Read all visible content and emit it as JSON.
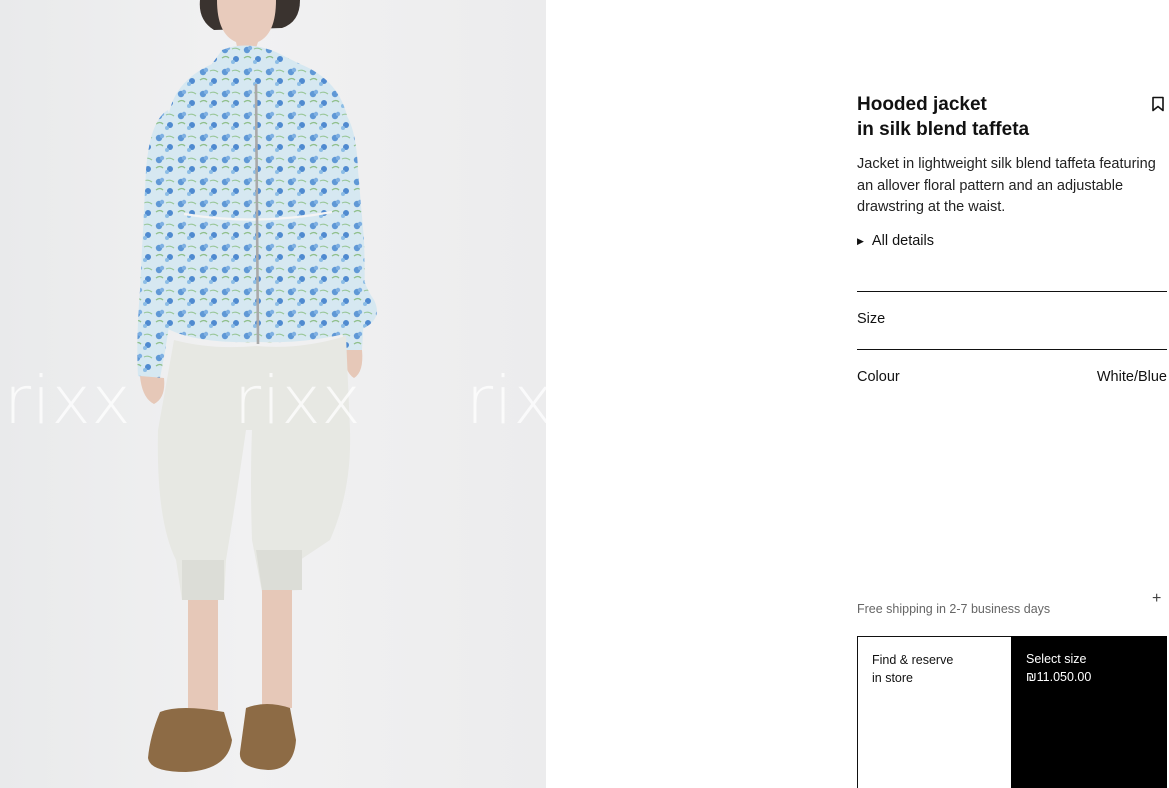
{
  "image": {
    "watermarks": [
      "rixx",
      "rixx",
      "rixx"
    ]
  },
  "product": {
    "title_line1": "Hooded jacket",
    "title_line2": "in silk blend taffeta",
    "description": "Jacket in lightweight silk blend taffeta featuring an allover floral pattern and an adjustable drawstring at the waist.",
    "details_label": "All details",
    "bookmark_icon": "bookmark-icon"
  },
  "options": {
    "size_label": "Size",
    "colour_label": "Colour",
    "colour_value": "White/Blue"
  },
  "shipping": {
    "text": "Free shipping in 2-7 business days",
    "expand_icon": "plus-icon"
  },
  "actions": {
    "find_line1": "Find & reserve",
    "find_line2": "in store",
    "select_label": "Select size",
    "price": "₪11.050.00"
  },
  "colors": {
    "accent": "#000000",
    "jacket": "#cfe3ee",
    "print": "#5e97d4",
    "trousers": "#e6e7e2",
    "shoes": "#8d6b45"
  }
}
